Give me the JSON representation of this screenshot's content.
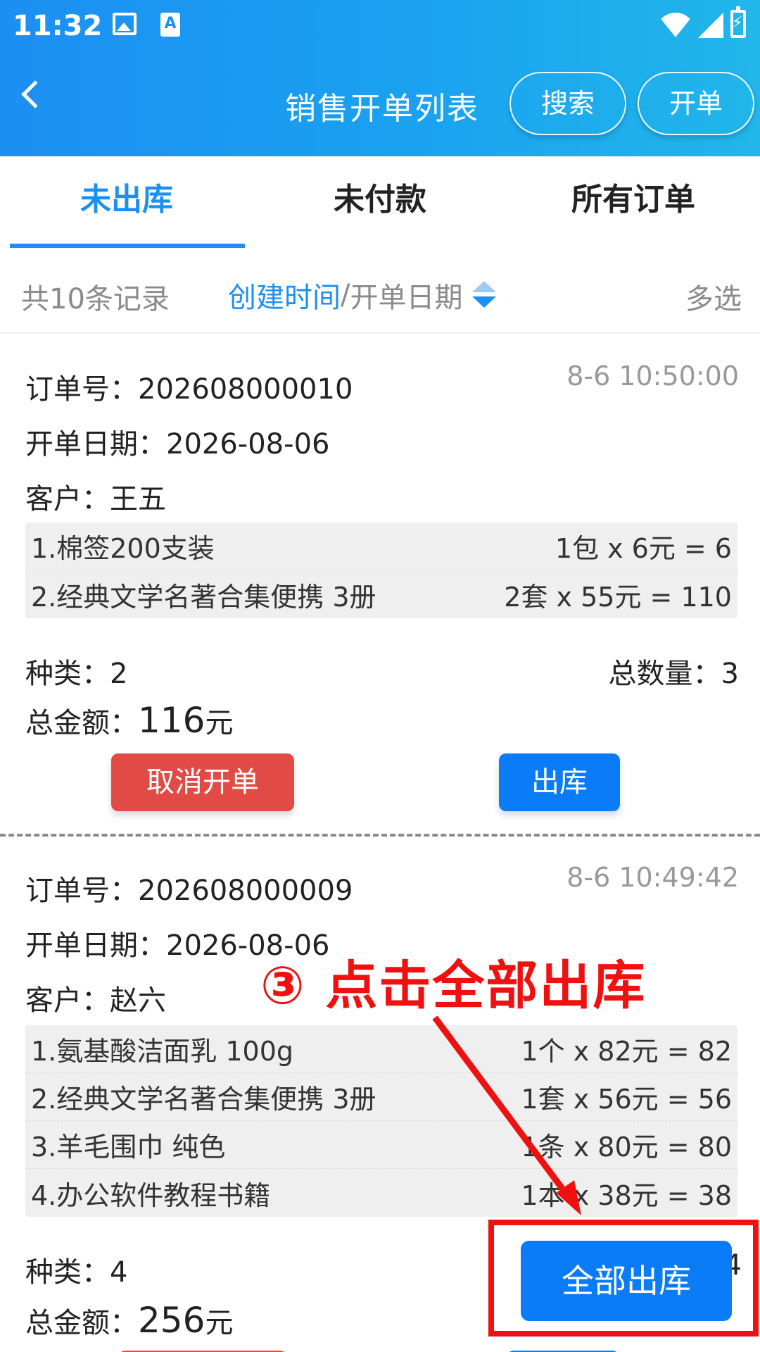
{
  "status_bar": {
    "time": "11:32"
  },
  "header": {
    "title": "销售开单列表",
    "search_label": "搜索",
    "create_label": "开单"
  },
  "tabs": [
    {
      "label": "未出库",
      "active": true
    },
    {
      "label": "未付款",
      "active": false
    },
    {
      "label": "所有订单",
      "active": false
    }
  ],
  "filter": {
    "count_text": "共10条记录",
    "sort_active": "创建时间",
    "sort_separator": "/",
    "sort_inactive": "开单日期",
    "multi_select": "多选"
  },
  "orders": [
    {
      "order_no_label": "订单号：",
      "order_no": "202608000010",
      "time": "8-6 10:50:00",
      "date_label": "开单日期：",
      "date": "2026-08-06",
      "customer_label": "客户：",
      "customer": "王五",
      "items": [
        {
          "name": "1.棉签200支装",
          "price": "1包 x 6元 = 6"
        },
        {
          "name": "2.经典文学名著合集便携 3册",
          "price": "2套 x 55元 = 110"
        }
      ],
      "kinds_label": "种类：",
      "kinds": "2",
      "qty_label": "总数量：",
      "qty": "3",
      "total_label": "总金额：",
      "total": "116",
      "total_unit": "元",
      "cancel_label": "取消开单",
      "out_label": "出库"
    },
    {
      "order_no_label": "订单号：",
      "order_no": "202608000009",
      "time": "8-6 10:49:42",
      "date_label": "开单日期：",
      "date": "2026-08-06",
      "customer_label": "客户：",
      "customer": "赵六",
      "items": [
        {
          "name": "1.氨基酸洁面乳 100g",
          "price": "1个 x 82元 = 82"
        },
        {
          "name": "2.经典文学名著合集便携 3册",
          "price": "1套 x 56元 = 56"
        },
        {
          "name": "3.羊毛围巾 纯色",
          "price": "1条 x 80元 = 80"
        },
        {
          "name": "4.办公软件教程书籍",
          "price": "1本 x 38元 = 38"
        }
      ],
      "kinds_label": "种类：",
      "kinds": "4",
      "qty_partial": "4",
      "total_label": "总金额：",
      "total": "256",
      "total_unit": "元"
    }
  ],
  "annotation": {
    "text": "③ 点击全部出库",
    "color": "#f01010"
  },
  "bulk_out_button": "全部出库",
  "colors": {
    "primary": "#1b8ff2",
    "button_blue": "#0a7cf7",
    "cancel_red": "#e24b45"
  }
}
